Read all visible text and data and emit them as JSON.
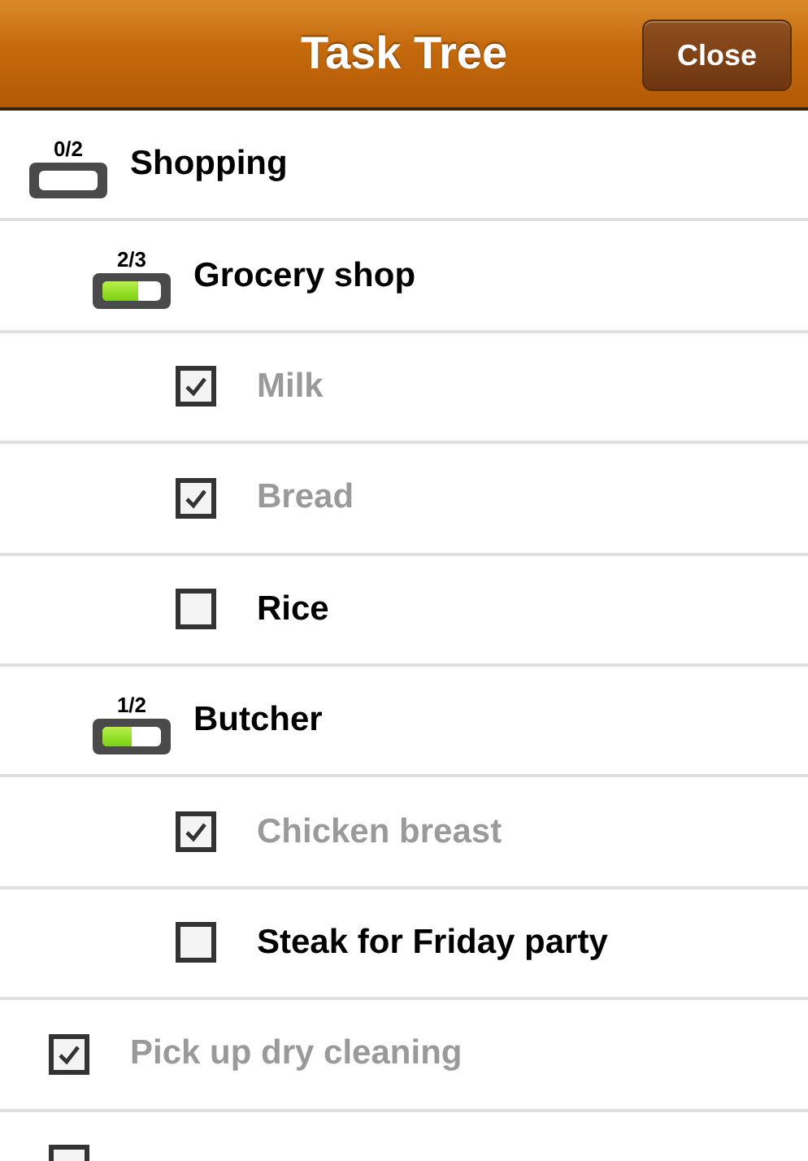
{
  "header": {
    "title": "Task Tree",
    "close_button": "Close"
  },
  "items": [
    {
      "kind": "group",
      "label": "Shopping",
      "count": "0/2",
      "level": 0,
      "children": [
        {
          "kind": "group",
          "label": "Grocery shop",
          "count": "2/3",
          "level": 0.6,
          "children": [
            {
              "kind": "task",
              "label": "Milk",
              "checked": true
            },
            {
              "kind": "task",
              "label": "Bread",
              "checked": true
            },
            {
              "kind": "task",
              "label": "Rice",
              "checked": false
            }
          ]
        },
        {
          "kind": "group",
          "label": "Butcher",
          "count": "1/2",
          "level": 0.5,
          "children": [
            {
              "kind": "task",
              "label": "Chicken breast",
              "checked": true
            },
            {
              "kind": "task",
              "label": "Steak for Friday party",
              "checked": false
            }
          ]
        }
      ]
    },
    {
      "kind": "task",
      "label": "Pick up dry cleaning",
      "checked": true
    },
    {
      "kind": "task",
      "checked": false
    }
  ]
}
